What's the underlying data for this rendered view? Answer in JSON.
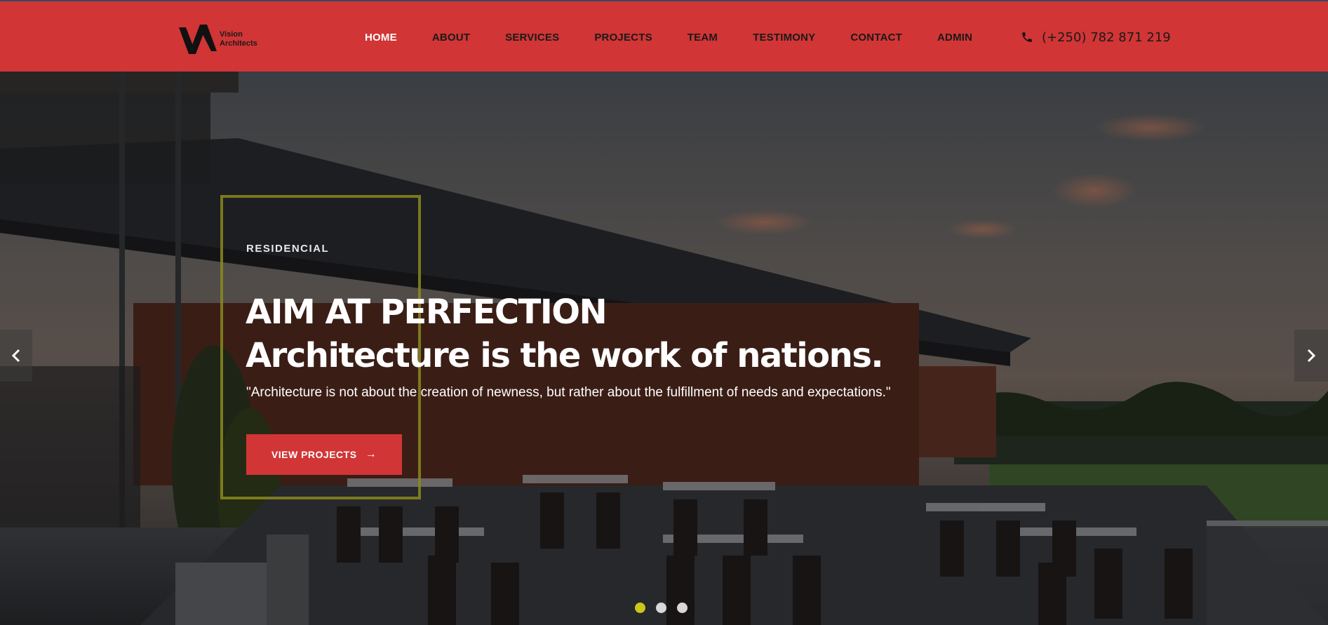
{
  "brand": {
    "line1": "Vision",
    "line2": "Architects"
  },
  "nav": {
    "items": [
      {
        "label": "HOME",
        "active": true
      },
      {
        "label": "ABOUT"
      },
      {
        "label": "SERVICES"
      },
      {
        "label": "PROJECTS"
      },
      {
        "label": "TEAM"
      },
      {
        "label": "TESTIMONY"
      },
      {
        "label": "CONTACT"
      },
      {
        "label": "ADMIN"
      }
    ]
  },
  "contact": {
    "phone": "(+250) 782 871 219",
    "icon": "phone-icon"
  },
  "hero": {
    "eyebrow": "RESIDENCIAL",
    "headline_line1": "AIM AT PERFECTION",
    "headline_line2": "Architecture is the work of nations.",
    "quote": "\"Architecture is not about the creation of newness, but rather about the fulfillment of needs and expectations.\"",
    "cta_label": "VIEW PROJECTS",
    "cta_icon": "arrow-right-icon"
  },
  "carousel": {
    "slide_count": 3,
    "active_slide": 1,
    "prev_icon": "chevron-left-icon",
    "next_icon": "chevron-right-icon"
  },
  "colors": {
    "brand_red": "#d13535",
    "accent_yellow": "#c8c81a",
    "frame_olive": "#8a8a1e"
  }
}
